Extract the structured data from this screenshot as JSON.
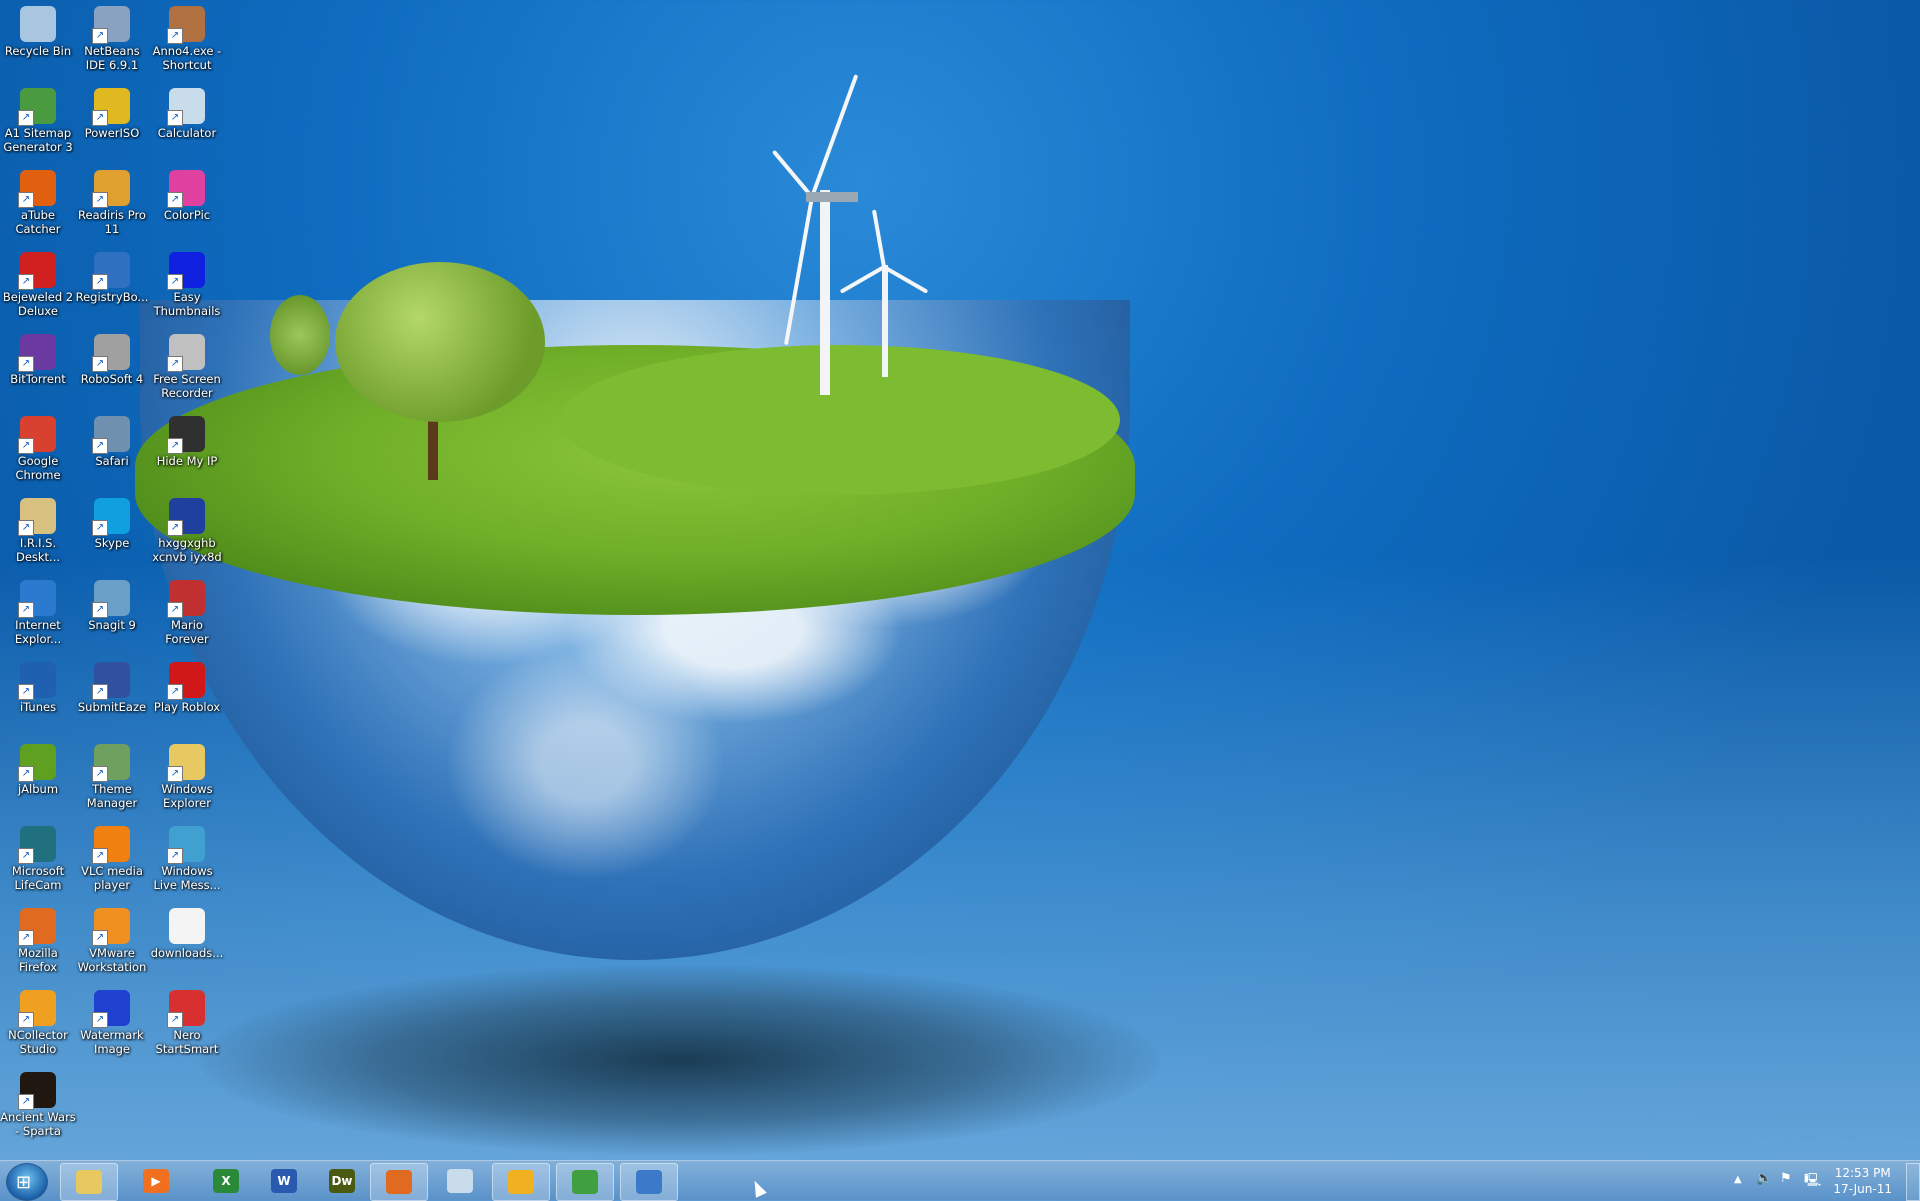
{
  "desktop": {
    "icons": [
      {
        "label": "Recycle Bin",
        "icon": "recycle-bin-icon",
        "color": "#a9c6e0",
        "shortcut": false
      },
      {
        "label": "NetBeans IDE 6.9.1",
        "icon": "netbeans-icon",
        "color": "#8aa2c2",
        "shortcut": true
      },
      {
        "label": "Anno4.exe - Shortcut",
        "icon": "anno4-icon",
        "color": "#b07040",
        "shortcut": true
      },
      {
        "label": "A1 Sitemap Generator 3",
        "icon": "a1-sitemap-icon",
        "color": "#4a9a40",
        "shortcut": true
      },
      {
        "label": "PowerISO",
        "icon": "poweriso-icon",
        "color": "#e0b820",
        "shortcut": true
      },
      {
        "label": "Calculator",
        "icon": "calculator-icon",
        "color": "#c8dcec",
        "shortcut": true
      },
      {
        "label": "aTube Catcher",
        "icon": "atube-catcher-icon",
        "color": "#e06010",
        "shortcut": true
      },
      {
        "label": "Readiris Pro 11",
        "icon": "readiris-icon",
        "color": "#e0a030",
        "shortcut": true
      },
      {
        "label": "ColorPic",
        "icon": "colorpic-icon",
        "color": "#e040a0",
        "shortcut": true
      },
      {
        "label": "Bejeweled 2 Deluxe",
        "icon": "bejeweled-icon",
        "color": "#d02020",
        "shortcut": true
      },
      {
        "label": "RegistryBo...",
        "icon": "registrybooster-icon",
        "color": "#3070c0",
        "shortcut": true
      },
      {
        "label": "Easy Thumbnails",
        "icon": "easy-thumbnails-icon",
        "color": "#1020e0",
        "shortcut": true
      },
      {
        "label": "BitTorrent",
        "icon": "bittorrent-icon",
        "color": "#6a3aa0",
        "shortcut": true
      },
      {
        "label": "RoboSoft 4",
        "icon": "robosoft-icon",
        "color": "#a0a0a0",
        "shortcut": true
      },
      {
        "label": "Free Screen Recorder",
        "icon": "camera-icon",
        "color": "#c0c0c0",
        "shortcut": true
      },
      {
        "label": "Google Chrome",
        "icon": "chrome-icon",
        "color": "#d84030",
        "shortcut": true
      },
      {
        "label": "Safari",
        "icon": "safari-icon",
        "color": "#7090b0",
        "shortcut": true
      },
      {
        "label": "Hide My IP",
        "icon": "hide-my-ip-icon",
        "color": "#303030",
        "shortcut": true
      },
      {
        "label": "I.R.I.S. Deskt...",
        "icon": "iris-desktop-icon",
        "color": "#d8c080",
        "shortcut": true
      },
      {
        "label": "Skype",
        "icon": "skype-icon",
        "color": "#10a0e0",
        "shortcut": true
      },
      {
        "label": "hxggxghb xcnvb iyx8d",
        "icon": "shortcut-icon",
        "color": "#2040a0",
        "shortcut": true
      },
      {
        "label": "Internet Explor...",
        "icon": "internet-explorer-icon",
        "color": "#2a7ad0",
        "shortcut": true
      },
      {
        "label": "Snagit 9",
        "icon": "snagit-icon",
        "color": "#6aa0c8",
        "shortcut": true
      },
      {
        "label": "Mario Forever",
        "icon": "mario-icon",
        "color": "#c03030",
        "shortcut": true
      },
      {
        "label": "iTunes",
        "icon": "itunes-icon",
        "color": "#2060b0",
        "shortcut": true
      },
      {
        "label": "SubmitEaze",
        "icon": "gear-icon",
        "color": "#3050a0",
        "shortcut": true
      },
      {
        "label": "Play Roblox",
        "icon": "roblox-icon",
        "color": "#d01818",
        "shortcut": true
      },
      {
        "label": "jAlbum",
        "icon": "jalbum-icon",
        "color": "#60a020",
        "shortcut": true
      },
      {
        "label": "Theme Manager",
        "icon": "theme-manager-icon",
        "color": "#70a060",
        "shortcut": true
      },
      {
        "label": "Windows Explorer",
        "icon": "folder-icon",
        "color": "#e8c860",
        "shortcut": true
      },
      {
        "label": "Microsoft LifeCam",
        "icon": "lifecam-icon",
        "color": "#207080",
        "shortcut": true
      },
      {
        "label": "VLC media player",
        "icon": "vlc-icon",
        "color": "#f08010",
        "shortcut": true
      },
      {
        "label": "Windows Live Mess...",
        "icon": "messenger-icon",
        "color": "#40a0d0",
        "shortcut": true
      },
      {
        "label": "Mozilla Firefox",
        "icon": "firefox-icon",
        "color": "#e06a20",
        "shortcut": true
      },
      {
        "label": "VMware Workstation",
        "icon": "vmware-icon",
        "color": "#f09020",
        "shortcut": true
      },
      {
        "label": "downloads...",
        "icon": "text-file-icon",
        "color": "#f4f4f4",
        "shortcut": false
      },
      {
        "label": "NCollector Studio",
        "icon": "ncollector-icon",
        "color": "#f0a020",
        "shortcut": true
      },
      {
        "label": "Watermark Image",
        "icon": "watermark-icon",
        "color": "#2040d0",
        "shortcut": true
      },
      {
        "label": "Nero StartSmart",
        "icon": "nero-icon",
        "color": "#d83030",
        "shortcut": true
      },
      {
        "label": "Ancient Wars - Sparta",
        "icon": "ancient-wars-icon",
        "color": "#201810",
        "shortcut": true
      }
    ]
  },
  "taskbar": {
    "start": {
      "icon": "windows-start-orb-icon"
    },
    "buttons": [
      {
        "name": "windows-explorer",
        "icon": "folder-icon",
        "glyph": "",
        "color": "#e8c860",
        "pressed": true
      },
      {
        "name": "windows-media-player",
        "icon": "media-player-icon",
        "glyph": "▶",
        "color": "#f07020",
        "pressed": false
      },
      {
        "name": "excel",
        "icon": "excel-icon",
        "glyph": "X",
        "color": "#2a8a3a",
        "pressed": false
      },
      {
        "name": "word",
        "icon": "word-icon",
        "glyph": "W",
        "color": "#2a5ab0",
        "pressed": false
      },
      {
        "name": "dreamweaver",
        "icon": "dreamweaver-icon",
        "glyph": "Dw",
        "color": "#4a5a10",
        "pressed": false
      },
      {
        "name": "firefox",
        "icon": "firefox-icon",
        "glyph": "",
        "color": "#e06a20",
        "pressed": true
      },
      {
        "name": "calculator",
        "icon": "calculator-icon",
        "glyph": "",
        "color": "#c8dcec",
        "pressed": false
      },
      {
        "name": "outlook",
        "icon": "outlook-icon",
        "glyph": "",
        "color": "#f0b020",
        "pressed": true
      },
      {
        "name": "windows-live-messenger",
        "icon": "messenger-icon",
        "glyph": "",
        "color": "#40a040",
        "pressed": true
      },
      {
        "name": "control-panel-app",
        "icon": "control-panel-icon",
        "glyph": "",
        "color": "#3a7ac8",
        "pressed": true
      }
    ],
    "tray": {
      "icons": [
        "show-hidden-icons-icon",
        "volume-icon",
        "action-center-flag-icon",
        "network-icon"
      ],
      "time": "12:53 PM",
      "date": "17-Jun-11"
    }
  }
}
